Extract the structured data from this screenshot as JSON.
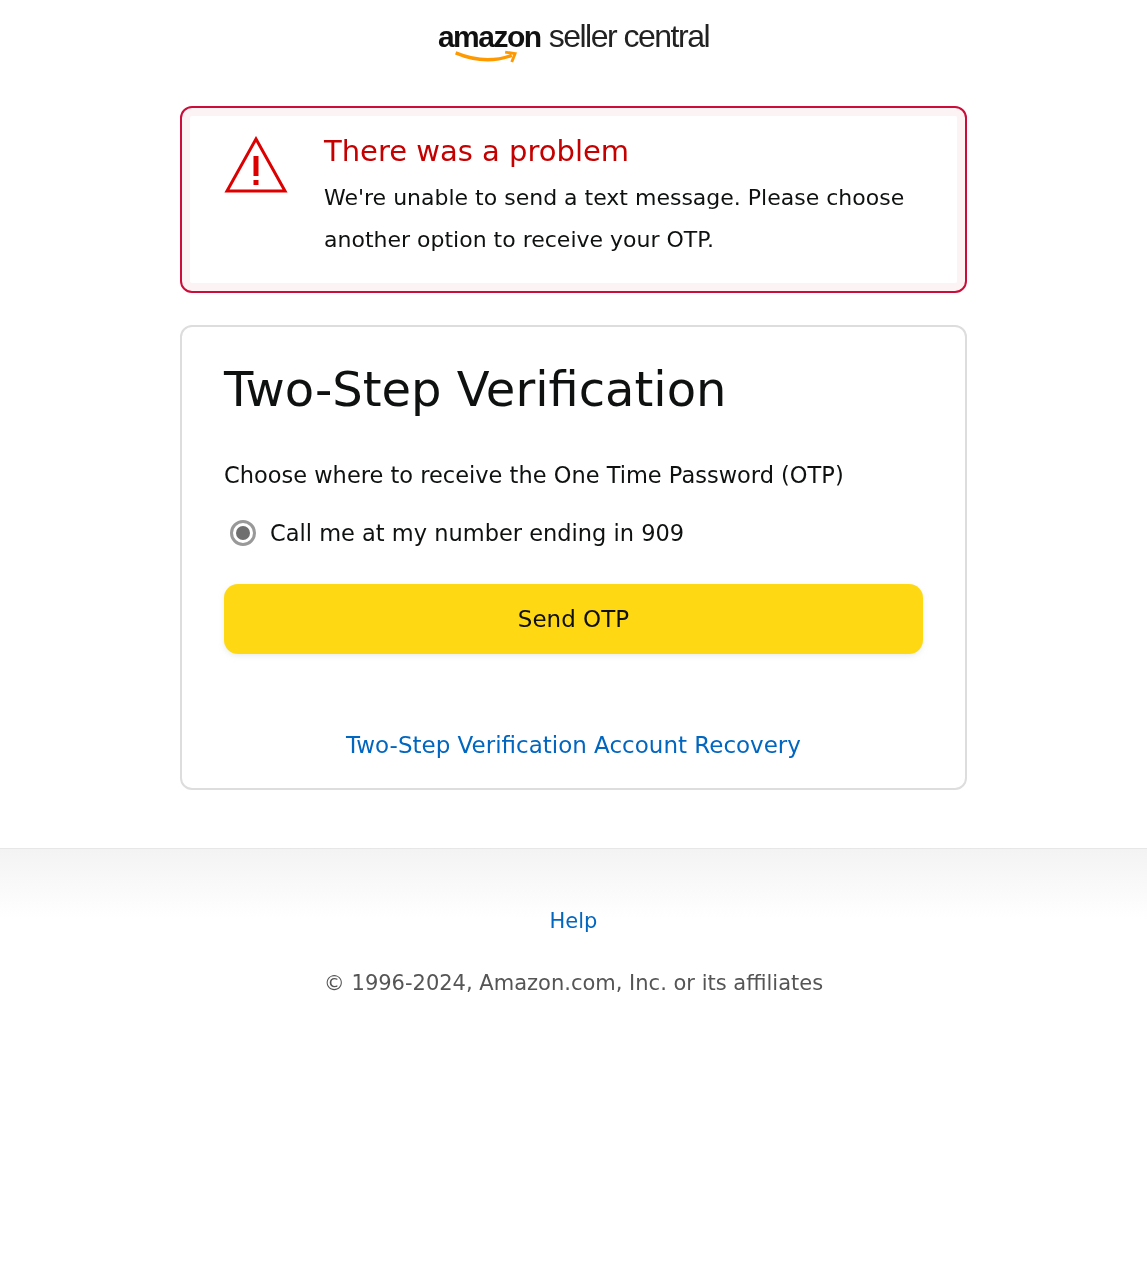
{
  "logo": {
    "brand": "amazon",
    "product": "seller central"
  },
  "alert": {
    "title": "There was a problem",
    "message": "We're unable to send a text message. Please choose another option to receive your OTP."
  },
  "card": {
    "title": "Two-Step Verification",
    "prompt": "Choose where to receive the One Time Password (OTP)",
    "options": [
      {
        "label": "Call me at my number ending in 909",
        "selected": true
      }
    ],
    "button": "Send OTP",
    "link": "Two-Step Verification Account Recovery"
  },
  "footer": {
    "link": "Help",
    "copyright": "© 1996-2024, Amazon.com, Inc. or its affiliates"
  }
}
